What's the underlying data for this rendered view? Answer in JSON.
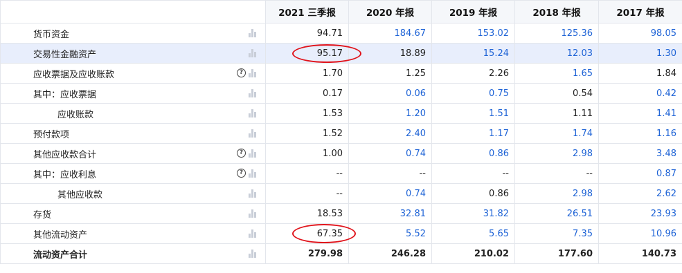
{
  "columns": [
    "2021 三季报",
    "2020 年报",
    "2019 年报",
    "2018 年报",
    "2017 年报"
  ],
  "rows": [
    {
      "label": "货币资金",
      "values": [
        "94.71",
        "184.67",
        "153.02",
        "125.36",
        "98.05"
      ]
    },
    {
      "label": "交易性金融资产",
      "values": [
        "95.17",
        "18.89",
        "15.24",
        "12.03",
        "1.30"
      ]
    },
    {
      "label": "应收票据及应收账款",
      "values": [
        "1.70",
        "1.25",
        "2.26",
        "1.65",
        "1.84"
      ]
    },
    {
      "label": "其中：应收票据",
      "values": [
        "0.17",
        "0.06",
        "0.75",
        "0.54",
        "0.42"
      ]
    },
    {
      "label": "应收账款",
      "values": [
        "1.53",
        "1.20",
        "1.51",
        "1.11",
        "1.41"
      ]
    },
    {
      "label": "预付款项",
      "values": [
        "1.52",
        "2.40",
        "1.17",
        "1.74",
        "1.16"
      ]
    },
    {
      "label": "其他应收款合计",
      "values": [
        "1.00",
        "0.74",
        "0.86",
        "2.98",
        "3.48"
      ]
    },
    {
      "label": "其中：应收利息",
      "values": [
        "--",
        "--",
        "--",
        "--",
        "0.87"
      ]
    },
    {
      "label": "其他应收款",
      "values": [
        "--",
        "0.74",
        "0.86",
        "2.98",
        "2.62"
      ]
    },
    {
      "label": "存货",
      "values": [
        "18.53",
        "32.81",
        "31.82",
        "26.51",
        "23.93"
      ]
    },
    {
      "label": "其他流动资产",
      "values": [
        "67.35",
        "5.52",
        "5.65",
        "7.35",
        "10.96"
      ]
    },
    {
      "label": "流动资产合计",
      "values": [
        "279.98",
        "246.28",
        "210.02",
        "177.60",
        "140.73"
      ]
    }
  ],
  "icons": {
    "chart": "bar-chart-icon",
    "help": "help-circle-icon"
  },
  "colors": {
    "link_blue": "#1e63d6",
    "highlight_row": "#e8eefc",
    "annotation_red": "#e0131b",
    "header_bg": "#f5f7fa"
  }
}
